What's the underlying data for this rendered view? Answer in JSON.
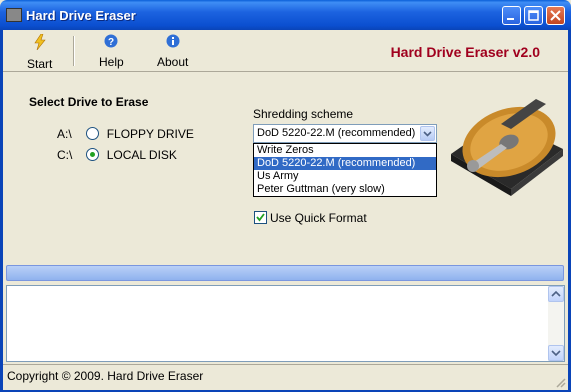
{
  "window": {
    "title": "Hard Drive Eraser"
  },
  "toolbar": {
    "start_label": "Start",
    "help_label": "Help",
    "about_label": "About"
  },
  "brand": "Hard Drive Eraser v2.0",
  "drives": {
    "section_title": "Select Drive to Erase",
    "items": [
      {
        "letter": "A:\\",
        "label": "FLOPPY DRIVE",
        "checked": false
      },
      {
        "letter": "C:\\",
        "label": "LOCAL DISK",
        "checked": true
      }
    ]
  },
  "shredding": {
    "label": "Shredding scheme",
    "selected": "DoD 5220-22.M (recommended)",
    "options": [
      "Write Zeros",
      "DoD 5220-22.M (recommended)",
      "Us Army",
      "Peter Guttman (very slow)"
    ],
    "quick_format_label": "Use Quick Format",
    "quick_format_checked": true
  },
  "status": {
    "text": "Copyright © 2009. Hard Drive Eraser"
  },
  "colors": {
    "titlebar": "#0b4fd0",
    "brand": "#a0001e",
    "selection": "#316ac5"
  },
  "icons": {
    "start": "lightning-icon",
    "help": "help-icon",
    "about": "info-icon",
    "drive": "hard-drive-icon"
  }
}
